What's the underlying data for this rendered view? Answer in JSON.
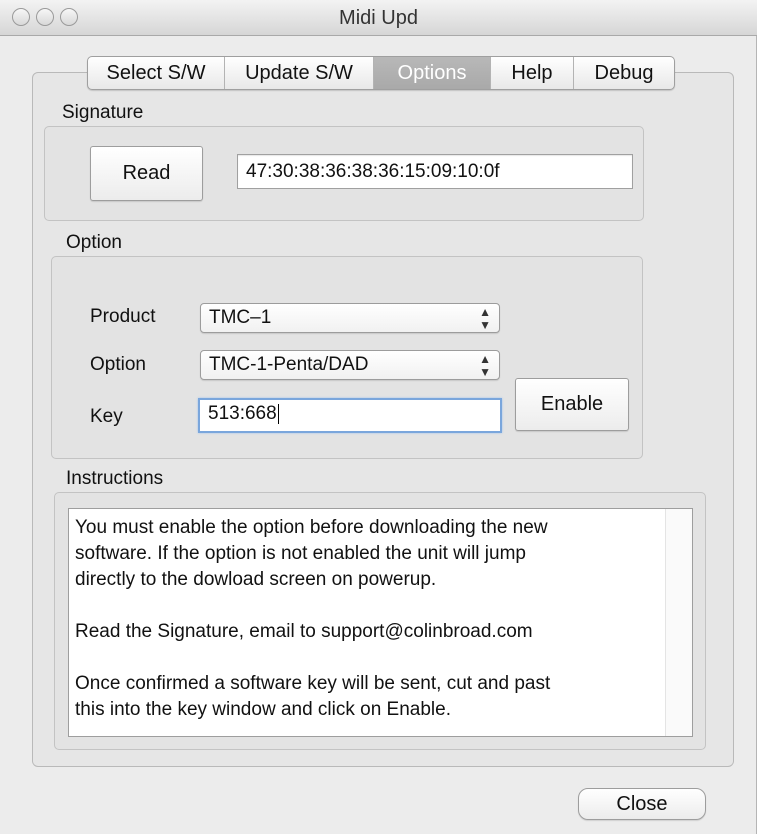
{
  "window": {
    "title": "Midi  Upd"
  },
  "tabs": [
    {
      "label": "Select S/W",
      "active": false
    },
    {
      "label": "Update S/W",
      "active": false
    },
    {
      "label": "Options",
      "active": true
    },
    {
      "label": "Help",
      "active": false
    },
    {
      "label": "Debug",
      "active": false
    }
  ],
  "signature": {
    "section_label": "Signature",
    "read_label": "Read",
    "value": "47:30:38:36:38:36:15:09:10:0f"
  },
  "option": {
    "section_label": "Option",
    "product_label": "Product",
    "product_value": "TMC–1",
    "option_label": "Option",
    "option_value": "TMC-1-Penta/DAD",
    "key_label": "Key",
    "key_value": "513:668",
    "enable_label": "Enable"
  },
  "instructions": {
    "section_label": "Instructions",
    "paragraphs": [
      "You must enable the option before downloading the new\nsoftware. If the option is not enabled the unit will jump\ndirectly to the dowload screen on powerup.",
      "Read the Signature, email to support@colinbroad.com",
      "Once confirmed a software key will be sent, cut and past\nthis into the key window and click on Enable."
    ]
  },
  "close_label": "Close",
  "icons": {
    "window_controls": [
      "close-dot",
      "minimize-dot",
      "zoom-dot"
    ],
    "select_arrows": "up-down-chevron"
  }
}
